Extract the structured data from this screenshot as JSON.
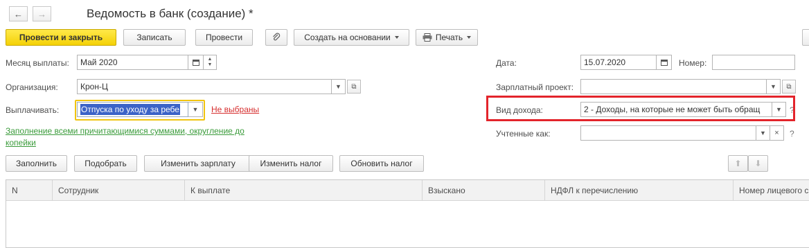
{
  "window": {
    "title": "Ведомость в банк (создание) *"
  },
  "nav": {
    "back_icon": "arrow-left-icon",
    "forward_icon": "arrow-right-icon"
  },
  "toolbar": {
    "post_close_label": "Провести и закрыть",
    "write_label": "Записать",
    "post_label": "Провести",
    "attach_icon": "paperclip-icon",
    "create_based_label": "Создать на основании",
    "print_label": "Печать"
  },
  "form": {
    "pay_month_label": "Месяц выплаты:",
    "pay_month_value": "Май 2020",
    "org_label": "Организация:",
    "org_value": "Крон-Ц",
    "pay_label": "Выплачивать:",
    "pay_value": "Отпуска по уходу за ребе",
    "not_selected_link": "Не выбраны",
    "fill_link": "Заполнение всеми причитающимися суммами, округление до копейки",
    "date_label": "Дата:",
    "date_value": "15.07.2020",
    "number_label": "Номер:",
    "number_value": "",
    "salary_project_label": "Зарплатный проект:",
    "salary_project_value": "",
    "income_type_label": "Вид дохода:",
    "income_type_value": "2 - Доходы, на которые не может быть обращ",
    "help_mark": "?",
    "accounted_as_label": "Учтенные как:",
    "accounted_as_value": ""
  },
  "actions": {
    "fill_label": "Заполнить",
    "pick_label": "Подобрать",
    "change_salary_label": "Изменить зарплату",
    "change_tax_label": "Изменить налог",
    "update_tax_label": "Обновить налог"
  },
  "table": {
    "columns": [
      "N",
      "Сотрудник",
      "К выплате",
      "Взыскано",
      "НДФЛ к перечислению",
      "Номер лицевого с"
    ]
  },
  "colors": {
    "primary_button": "#f4d106",
    "highlight_border": "#e3242b",
    "link_red": "#d62e2e",
    "link_green": "#3a9b3a",
    "selection": "#3b63c7"
  }
}
